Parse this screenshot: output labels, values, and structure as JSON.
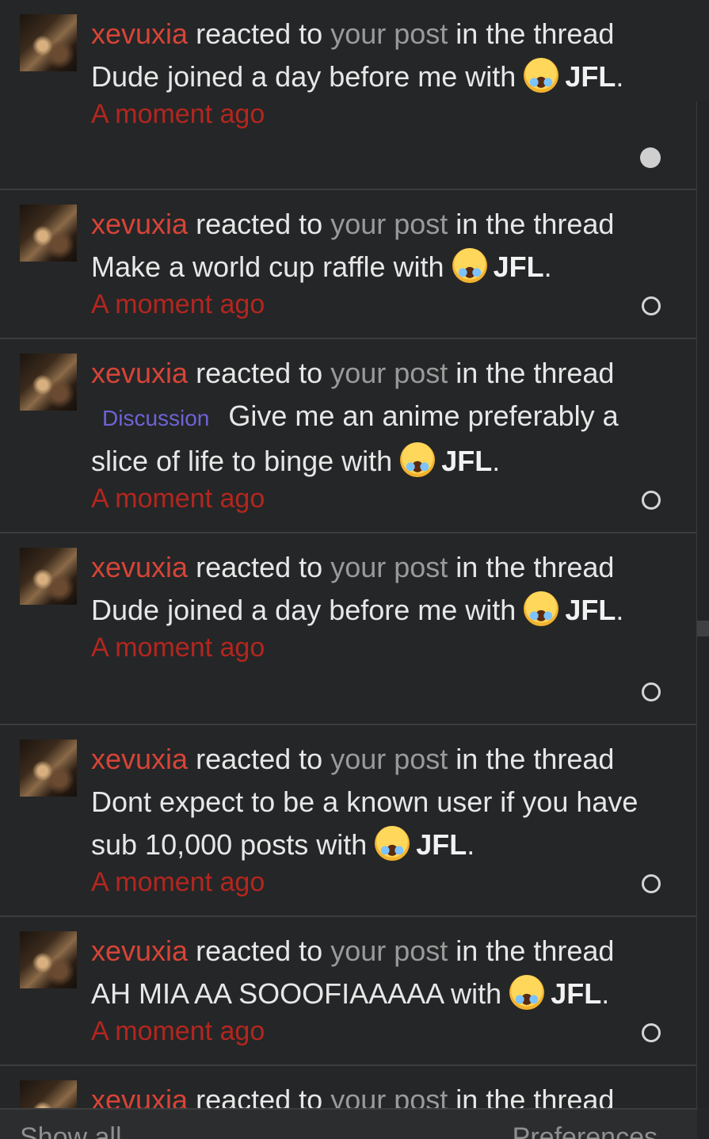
{
  "notifications": [
    {
      "user": "xevuxia",
      "verb": "reacted to",
      "target": "your post",
      "context": "in the thread",
      "thread_prefix": "",
      "thread": "Dude joined a day before me with",
      "reaction": "JFL",
      "time": "A moment ago",
      "unread": true
    },
    {
      "user": "xevuxia",
      "verb": "reacted to",
      "target": "your post",
      "context": "in the thread",
      "thread_prefix": "",
      "thread": "Make a world cup raffle with",
      "reaction": "JFL",
      "time": "A moment ago",
      "unread": false
    },
    {
      "user": "xevuxia",
      "verb": "reacted to",
      "target": "your post",
      "context": "in the thread",
      "thread_prefix": "Discussion",
      "thread": "Give me an anime preferably a slice of life to binge with",
      "reaction": "JFL",
      "time": "A moment ago",
      "unread": false
    },
    {
      "user": "xevuxia",
      "verb": "reacted to",
      "target": "your post",
      "context": "in the thread",
      "thread_prefix": "",
      "thread": "Dude joined a day before me with",
      "reaction": "JFL",
      "time": "A moment ago",
      "unread": false
    },
    {
      "user": "xevuxia",
      "verb": "reacted to",
      "target": "your post",
      "context": "in the thread",
      "thread_prefix": "",
      "thread": "Dont expect to be a known user if you have sub 10,000 posts with",
      "reaction": "JFL",
      "time": "A moment ago",
      "unread": false
    },
    {
      "user": "xevuxia",
      "verb": "reacted to",
      "target": "your post",
      "context": "in the thread",
      "thread_prefix": "",
      "thread": "AH MIA AA SOOOFIAAAAA with",
      "reaction": "JFL",
      "time": "A moment ago",
      "unread": false
    },
    {
      "user": "xevuxia",
      "verb": "reacted to",
      "target": "your post",
      "context": "in the thread",
      "thread_prefix": "",
      "thread": "",
      "reaction": "",
      "time": "",
      "unread": false
    }
  ],
  "footer": {
    "show_all": "Show all",
    "preferences": "Preferences"
  },
  "colors": {
    "username": "#d74437",
    "time": "#b3261f",
    "prefix": "#6e63d6",
    "background": "#252627"
  },
  "icons": {
    "avatar": "user-avatar",
    "reaction": "face-with-tears-of-joy-icon"
  }
}
